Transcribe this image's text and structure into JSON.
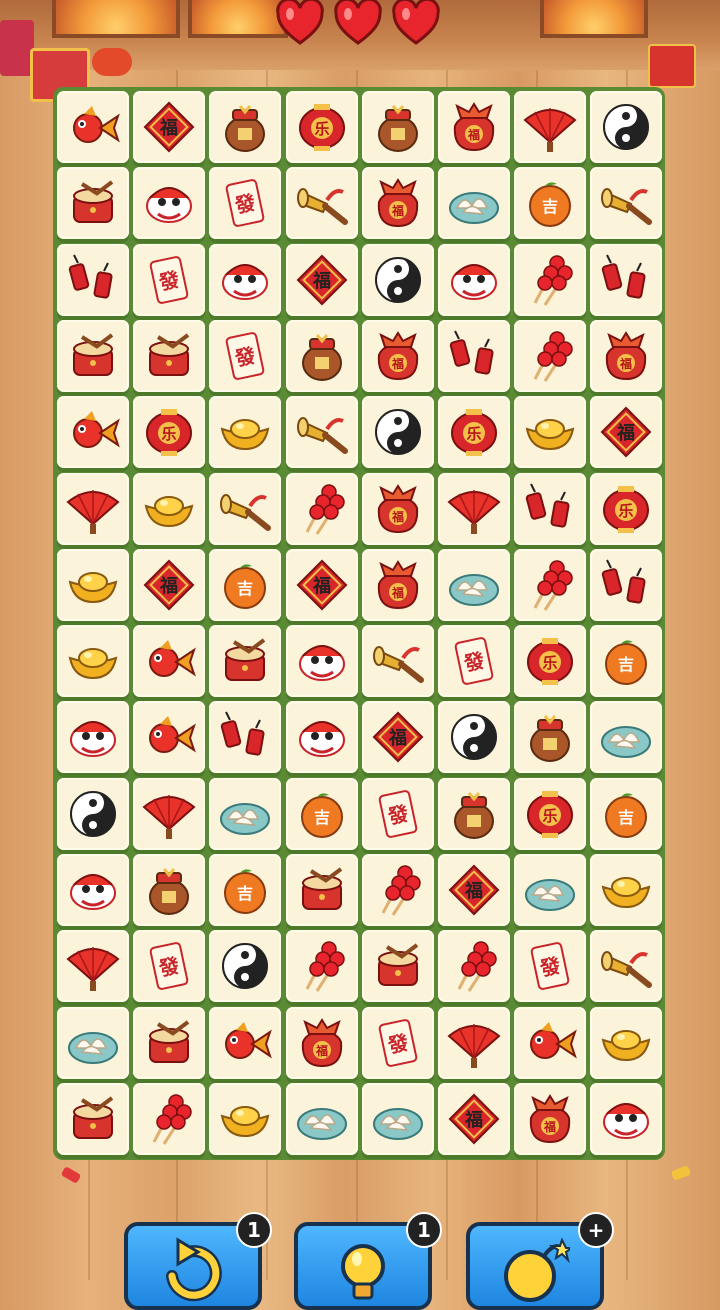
{
  "hud": {
    "lives": 3,
    "heart_icon": "heart-icon"
  },
  "tile_types": {
    "fish": {
      "name": "koi-fish-icon"
    },
    "fu": {
      "name": "fu-diamond-icon",
      "text": "福"
    },
    "urn": {
      "name": "wine-urn-icon"
    },
    "lantern": {
      "name": "lantern-icon",
      "text": "乐"
    },
    "bag": {
      "name": "lucky-bag-icon",
      "text": "福"
    },
    "fan": {
      "name": "red-fan-icon"
    },
    "yinyang": {
      "name": "yin-yang-icon"
    },
    "drum": {
      "name": "drum-icon"
    },
    "lion": {
      "name": "lion-dance-icon"
    },
    "mahjong": {
      "name": "mahjong-fa-icon",
      "text": "發"
    },
    "horn": {
      "name": "suona-horn-icon"
    },
    "dumpling": {
      "name": "dumplings-icon"
    },
    "orange": {
      "name": "ji-orange-icon",
      "text": "吉"
    },
    "cracker": {
      "name": "firecracker-icon"
    },
    "haws": {
      "name": "candied-haws-icon"
    },
    "ingot": {
      "name": "gold-ingot-icon"
    }
  },
  "board": {
    "rows": [
      [
        "fish",
        "fu",
        "urn",
        "lantern",
        "urn",
        "bag",
        "fan",
        "yinyang"
      ],
      [
        "drum",
        "lion",
        "mahjong",
        "horn",
        "bag",
        "dumpling",
        "orange",
        "horn"
      ],
      [
        "cracker",
        "mahjong",
        "lion",
        "fu",
        "yinyang",
        "lion",
        "haws",
        "cracker"
      ],
      [
        "drum",
        "drum",
        "mahjong",
        "urn",
        "bag",
        "cracker",
        "haws",
        "bag"
      ],
      [
        "fish",
        "lantern",
        "ingot",
        "horn",
        "yinyang",
        "lantern",
        "ingot",
        "fu"
      ],
      [
        "fan",
        "ingot",
        "horn",
        "haws",
        "bag",
        "fan",
        "cracker",
        "lantern"
      ],
      [
        "ingot",
        "fu",
        "orange",
        "fu",
        "bag",
        "dumpling",
        "haws",
        "cracker"
      ],
      [
        "ingot",
        "fish",
        "drum",
        "lion",
        "horn",
        "mahjong",
        "lantern",
        "orange"
      ],
      [
        "lion",
        "fish",
        "cracker",
        "lion",
        "fu",
        "yinyang",
        "urn",
        "dumpling"
      ],
      [
        "yinyang",
        "fan",
        "dumpling",
        "orange",
        "mahjong",
        "urn",
        "lantern",
        "orange"
      ],
      [
        "lion",
        "urn",
        "orange",
        "drum",
        "haws",
        "fu",
        "dumpling",
        "ingot"
      ],
      [
        "fan",
        "mahjong",
        "yinyang",
        "haws",
        "drum",
        "haws",
        "mahjong",
        "horn"
      ],
      [
        "dumpling",
        "drum",
        "fish",
        "bag",
        "mahjong",
        "fan",
        "fish",
        "ingot"
      ],
      [
        "drum",
        "haws",
        "ingot",
        "dumpling",
        "dumpling",
        "fu",
        "bag",
        "lion"
      ]
    ]
  },
  "toolbar": {
    "undo": {
      "icon": "undo-icon",
      "count": "1"
    },
    "hint": {
      "icon": "lightbulb-icon",
      "count": "1"
    },
    "bomb": {
      "icon": "bomb-icon",
      "count": "+"
    }
  },
  "colors": {
    "board_green": "#5a8a34",
    "tile_cream": "#fbf4da",
    "tool_blue": "#1e86e0",
    "heart_red": "#e8242c"
  }
}
